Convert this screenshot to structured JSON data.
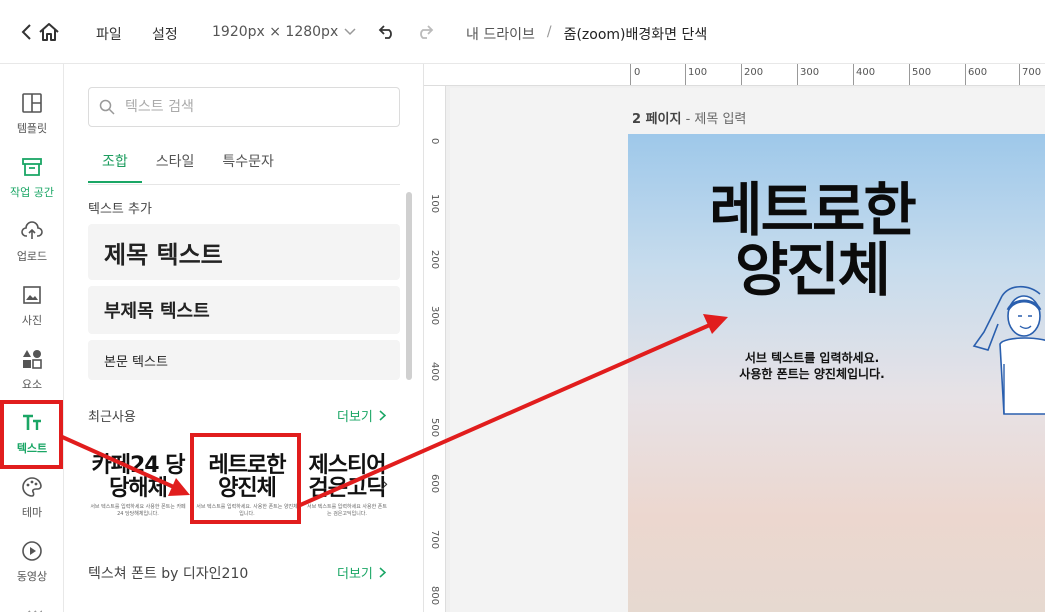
{
  "topbar": {
    "menu_file": "파일",
    "menu_settings": "설정",
    "canvas_size": "1920px × 1280px",
    "breadcrumb_root": "내 드라이브",
    "breadcrumb_sep": "/",
    "breadcrumb_current": "줌(zoom)배경화면 단색"
  },
  "rail": {
    "items": [
      {
        "label": "템플릿",
        "icon": "template-icon"
      },
      {
        "label": "작업 공간",
        "icon": "workspace-icon"
      },
      {
        "label": "업로드",
        "icon": "upload-icon"
      },
      {
        "label": "사진",
        "icon": "photo-icon"
      },
      {
        "label": "요소",
        "icon": "elements-icon"
      },
      {
        "label": "텍스트",
        "icon": "text-icon"
      },
      {
        "label": "테마",
        "icon": "palette-icon"
      },
      {
        "label": "동영상",
        "icon": "video-icon"
      }
    ]
  },
  "panel": {
    "search_placeholder": "텍스트 검색",
    "tabs": [
      "조합",
      "스타일",
      "특수문자"
    ],
    "add_text_title": "텍스트 추가",
    "preset_title": "제목 텍스트",
    "preset_subtitle": "부제목 텍스트",
    "preset_body": "본문 텍스트",
    "recent_title": "최근사용",
    "more_label": "더보기",
    "thumbs": [
      {
        "big": "카페24 당당해체",
        "small": "서브 텍스트를 입력하세요 사용한 폰트는 카페24 당당해체입니다."
      },
      {
        "big": "레트로한 양진체",
        "small": "서브 텍스트를 입력하세요. 사용한 폰트는 양진체입니다."
      },
      {
        "big": "제스티어 검은고딕",
        "small": "서브 텍스트를 입력하세요 사용한 폰트는 검은고딕입니다."
      }
    ],
    "texture_title": "텍스쳐 폰트 by 디자인210",
    "texture_more": "더보기"
  },
  "canvas": {
    "ruler_top": [
      "0",
      "100",
      "200",
      "300",
      "400",
      "500",
      "600",
      "700"
    ],
    "ruler_left": [
      "0",
      "100",
      "200",
      "300",
      "400",
      "500",
      "600",
      "700",
      "800"
    ],
    "page_label_num": "2 페이지",
    "page_label_rest": " - 제목 입력",
    "headline_line1": "레트로한",
    "headline_line2": "양진체",
    "sub_line1": "서브 텍스트를 입력하세요.",
    "sub_line2": "사용한 폰트는 양진체입니다."
  },
  "colors": {
    "accent": "#1aa665",
    "annotation": "#e11d1d"
  }
}
